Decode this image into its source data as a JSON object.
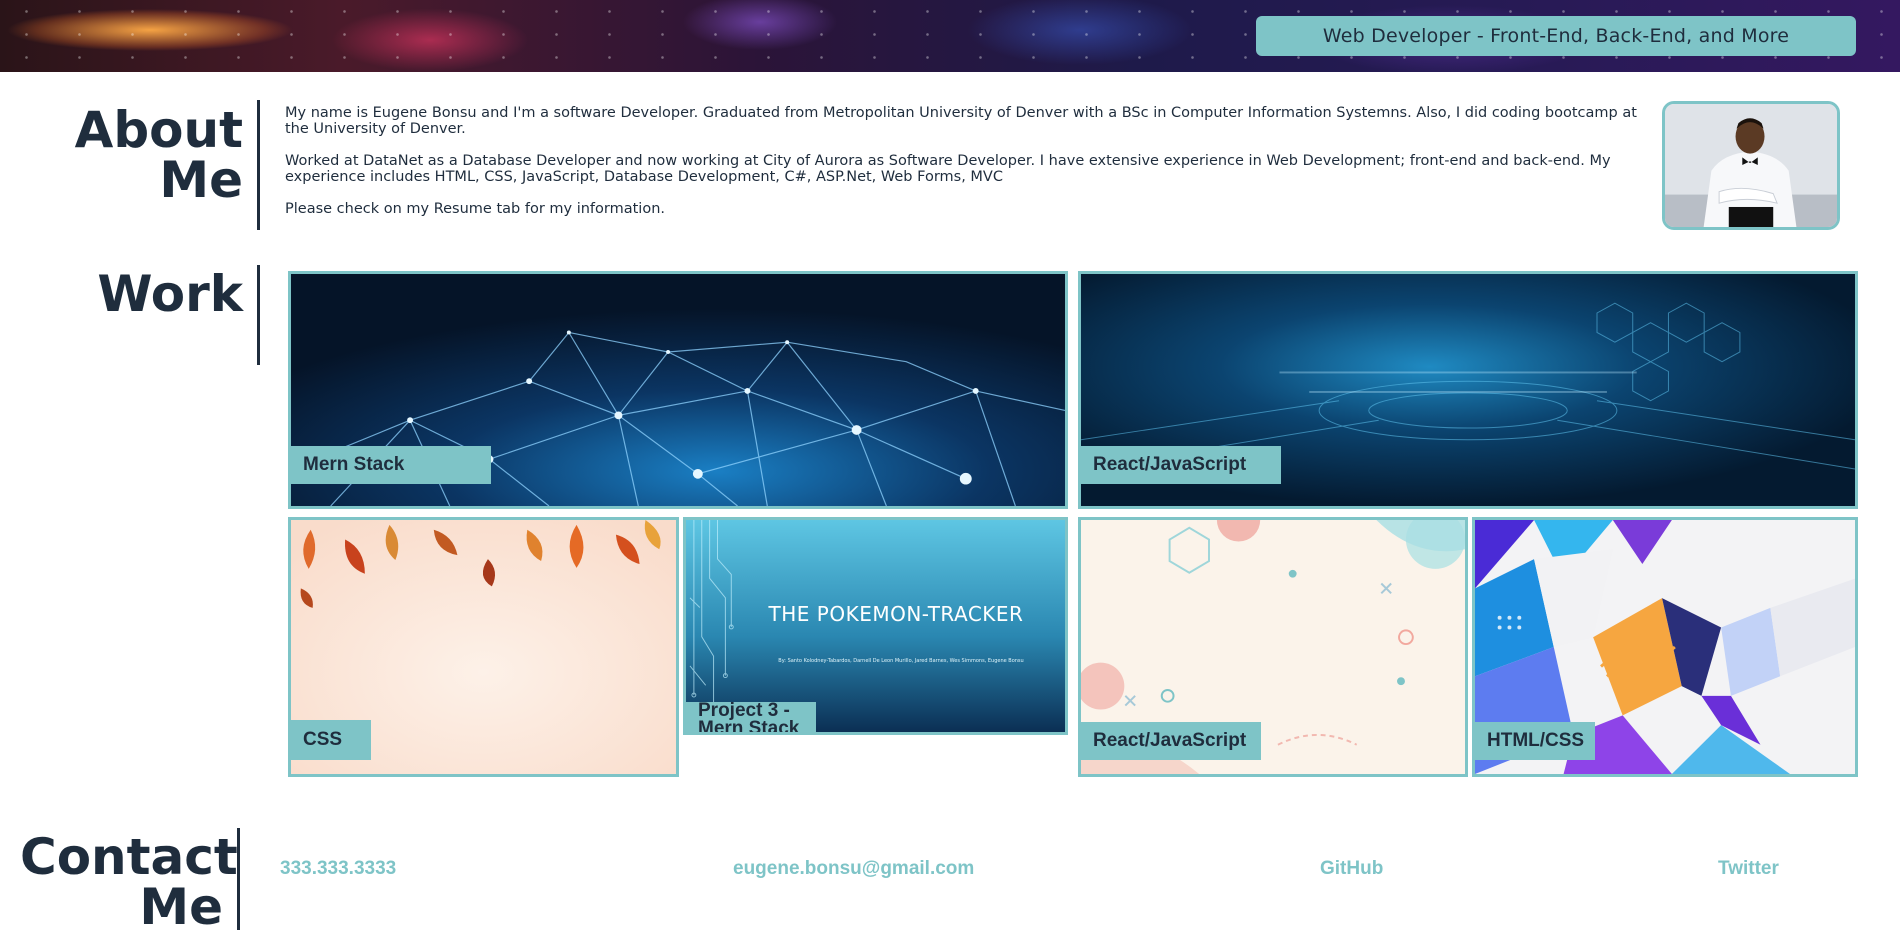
{
  "hero": {
    "title": "Web Developer - Front-End, Back-End, and More"
  },
  "about": {
    "heading_line1": "About",
    "heading_line2": "Me",
    "paragraphs": [
      "My name is Eugene Bonsu and I'm a software Developer. Graduated from Metropolitan University of Denver with a BSc in Computer Information Systemns. Also, I did coding bootcamp at the University of Denver.",
      "Worked at DataNet as a Database Developer and now working at City of Aurora as Software Developer. I have extensive experience in Web Development; front-end and back-end. My experience includes HTML, CSS, JavaScript, Database Development, C#, ASP.Net, Web Forms, MVC",
      "Please check on my Resume tab for my information."
    ]
  },
  "work": {
    "heading": "Work",
    "cards": [
      {
        "label": "Mern Stack",
        "image": "network-nodes-image"
      },
      {
        "label": "React/JavaScript",
        "image": "hexagon-tech-image"
      },
      {
        "label": "CSS",
        "image": "autumn-leaves-image"
      },
      {
        "label": "Project 3 -\nMern Stack",
        "image": "pokemon-tracker-slide",
        "slide_title": "THE POKEMON-TRACKER",
        "slide_subtitle": "By: Santo Kolodney-Tabardos, Darnell De Leon Murillo, Jared Barnes, Wes Simmons, Eugene Bonsu"
      },
      {
        "label": "React/JavaScript",
        "image": "geometric-pastel-image"
      },
      {
        "label": "HTML/CSS",
        "image": "colorful-geometric-image"
      }
    ]
  },
  "contact": {
    "heading_line1": "Contact",
    "heading_line2": "Me",
    "phone": "333.333.3333",
    "email": "eugene.bonsu@gmail.com",
    "github": "GitHub",
    "twitter": "Twitter"
  },
  "colors": {
    "accent": "#7ec4c7",
    "text": "#1f2d3d",
    "background": "#ffffff"
  }
}
